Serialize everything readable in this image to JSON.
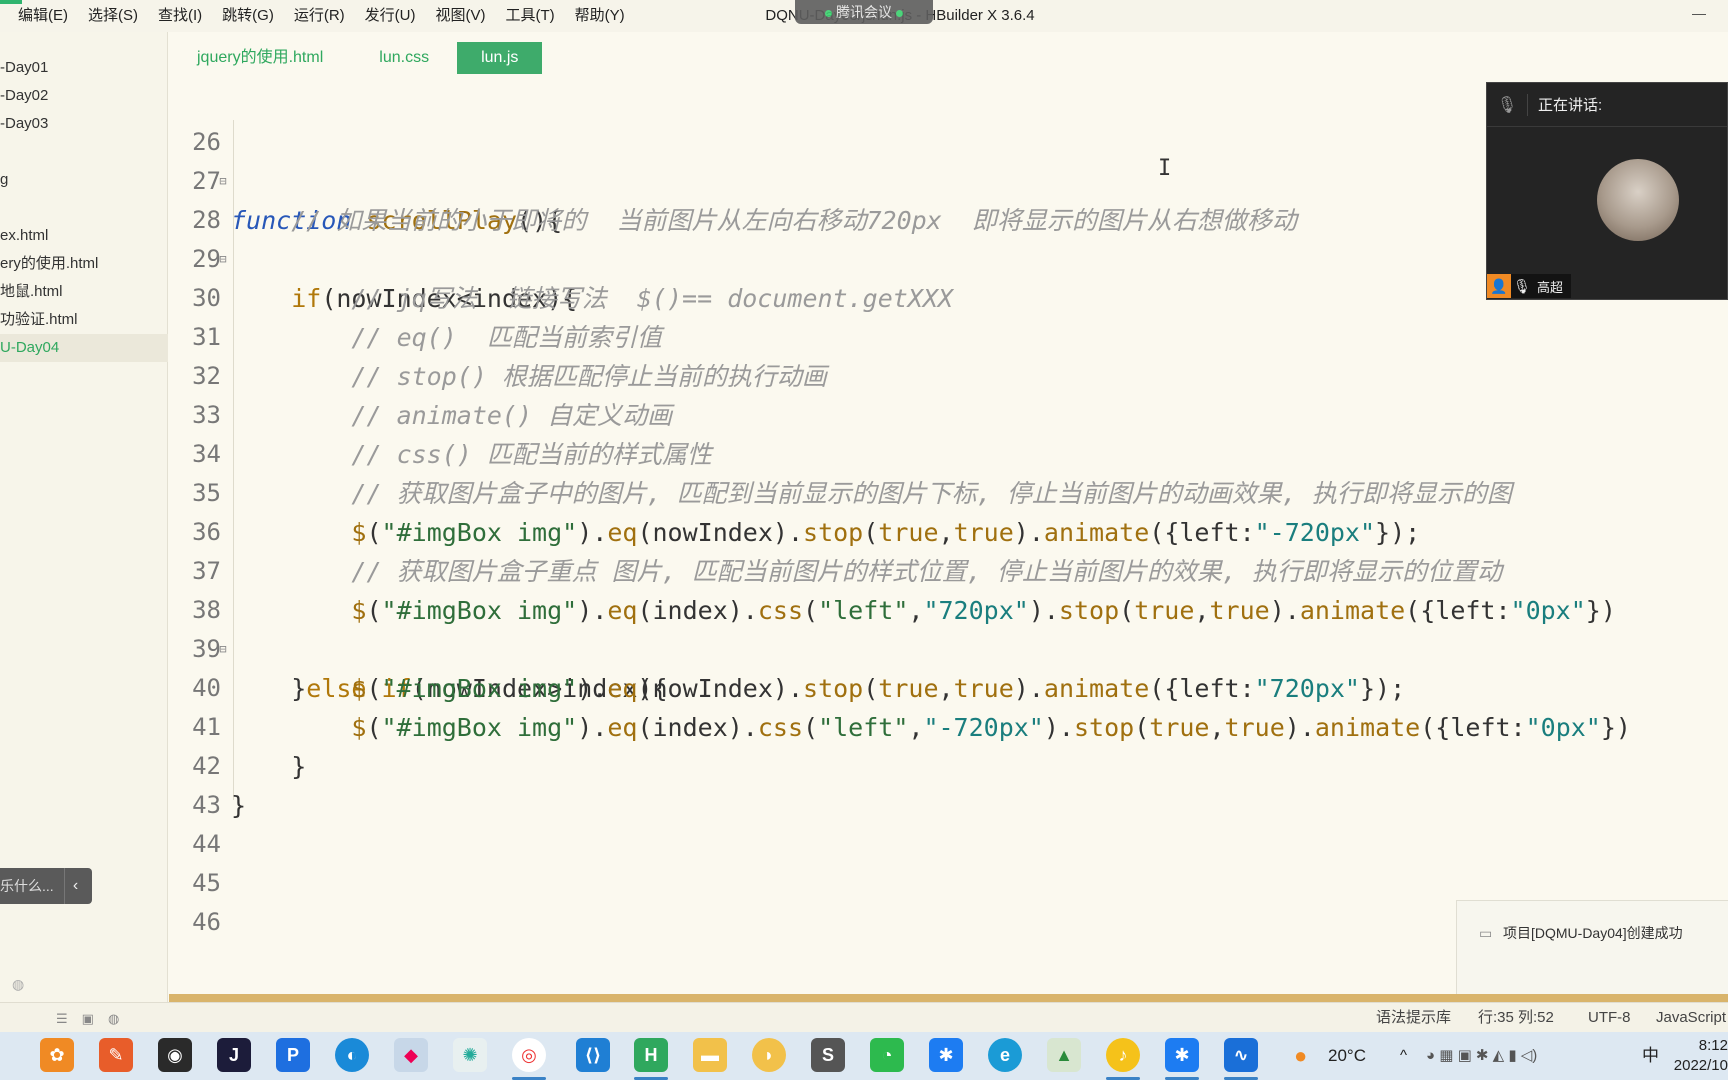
{
  "menubar": {
    "items": [
      "编辑(E)",
      "选择(S)",
      "查找(I)",
      "跳转(G)",
      "运行(R)",
      "发行(U)",
      "视图(V)",
      "工具(T)",
      "帮助(Y)"
    ],
    "window_title": "DQNU-Day03/js/lun.js - HBuilder X 3.6.4",
    "meeting_pill": "腾讯会议"
  },
  "sidebar": {
    "items": [
      "-Day01",
      "-Day02",
      "-Day03",
      "g",
      "ex.html",
      "ery的使用.html",
      "地鼠.html",
      "功验证.html",
      "U-Day04"
    ],
    "search_placeholder": "乐什么..."
  },
  "tabs": [
    "jquery的使用.html",
    "lun.css",
    "lun.js"
  ],
  "editor": {
    "line_numbers": [
      "26",
      "27",
      "28",
      "29",
      "30",
      "31",
      "32",
      "33",
      "34",
      "35",
      "36",
      "37",
      "38",
      "39",
      "40",
      "41",
      "42",
      "43",
      "44",
      "45",
      "46"
    ]
  },
  "meeting": {
    "speaking_label": "正在讲话:",
    "participant_name": "高超"
  },
  "toast": {
    "message": "项目[DQMU-Day04]创建成功"
  },
  "statusbar": {
    "syntax_hint": "语法提示库",
    "position": "行:35  列:52",
    "encoding": "UTF-8",
    "language": "JavaScript"
  },
  "taskbar": {
    "weather": "20°C",
    "ime": "中",
    "time": "8:12",
    "date": "2022/10"
  },
  "colors": {
    "accent_green": "#3eab6b",
    "editor_bg": "#fbf9ef",
    "keyword_fn": "#2757b8",
    "comment": "#9a9a9a"
  }
}
